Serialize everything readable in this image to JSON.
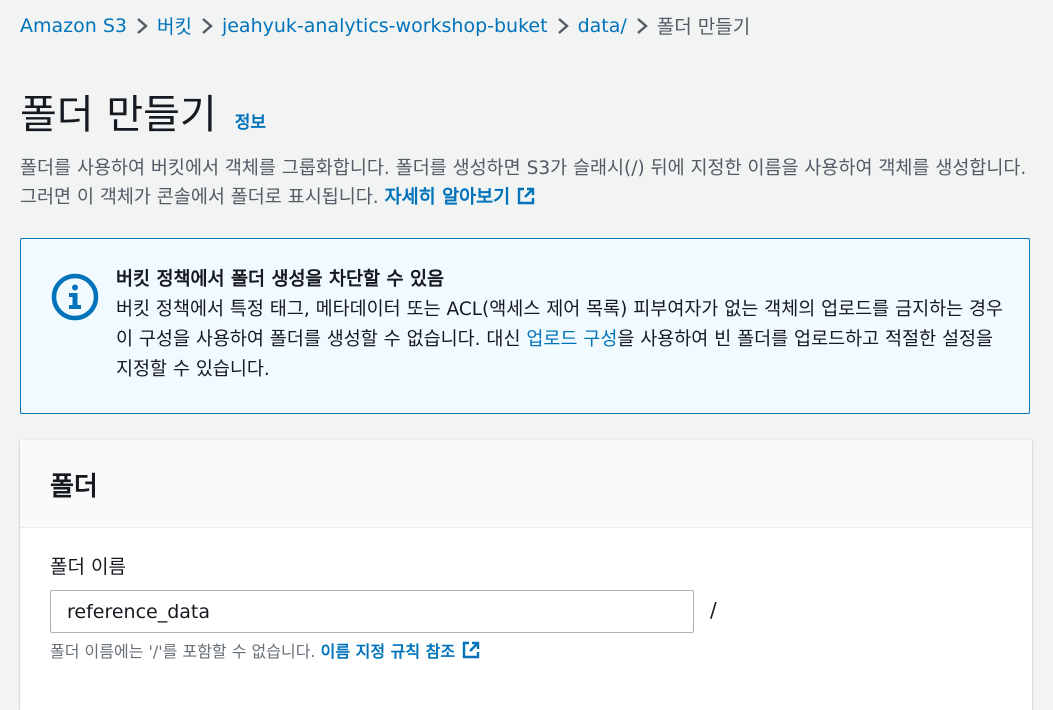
{
  "breadcrumb": {
    "items": [
      "Amazon S3",
      "버킷",
      "jeahyuk-analytics-workshop-buket",
      "data/"
    ],
    "current": "폴더 만들기"
  },
  "header": {
    "title": "폴더 만들기",
    "info_link": "정보"
  },
  "description": {
    "text": "폴더를 사용하여 버킷에서 객체를 그룹화합니다. 폴더를 생성하면 S3가 슬래시(/) 뒤에 지정한 이름을 사용하여 객체를 생성합니다. 그러면 이 객체가 콘솔에서 폴더로 표시됩니다.",
    "learn_more": "자세히 알아보기"
  },
  "alert": {
    "title": "버킷 정책에서 폴더 생성을 차단할 수 있음",
    "body_before": "버킷 정책에서 특정 태그, 메타데이터 또는 ACL(액세스 제어 목록) 피부여자가 없는 객체의 업로드를 금지하는 경우 이 구성을 사용하여 폴더를 생성할 수 없습니다. 대신 ",
    "link": "업로드 구성",
    "body_after": "을 사용하여 빈 폴더를 업로드하고 적절한 설정을 지정할 수 있습니다.",
    "icon": "info-icon",
    "color": "#0073bb"
  },
  "panel": {
    "title": "폴더",
    "field_label": "폴더 이름",
    "input_value": "reference_data",
    "suffix": "/",
    "hint_text": "폴더 이름에는 '/'를 포함할 수 없습니다.",
    "hint_link": "이름 지정 규칙 참조"
  },
  "colors": {
    "link": "#0073bb",
    "alert_bg": "#f1faff",
    "background": "#f2f3f3"
  }
}
